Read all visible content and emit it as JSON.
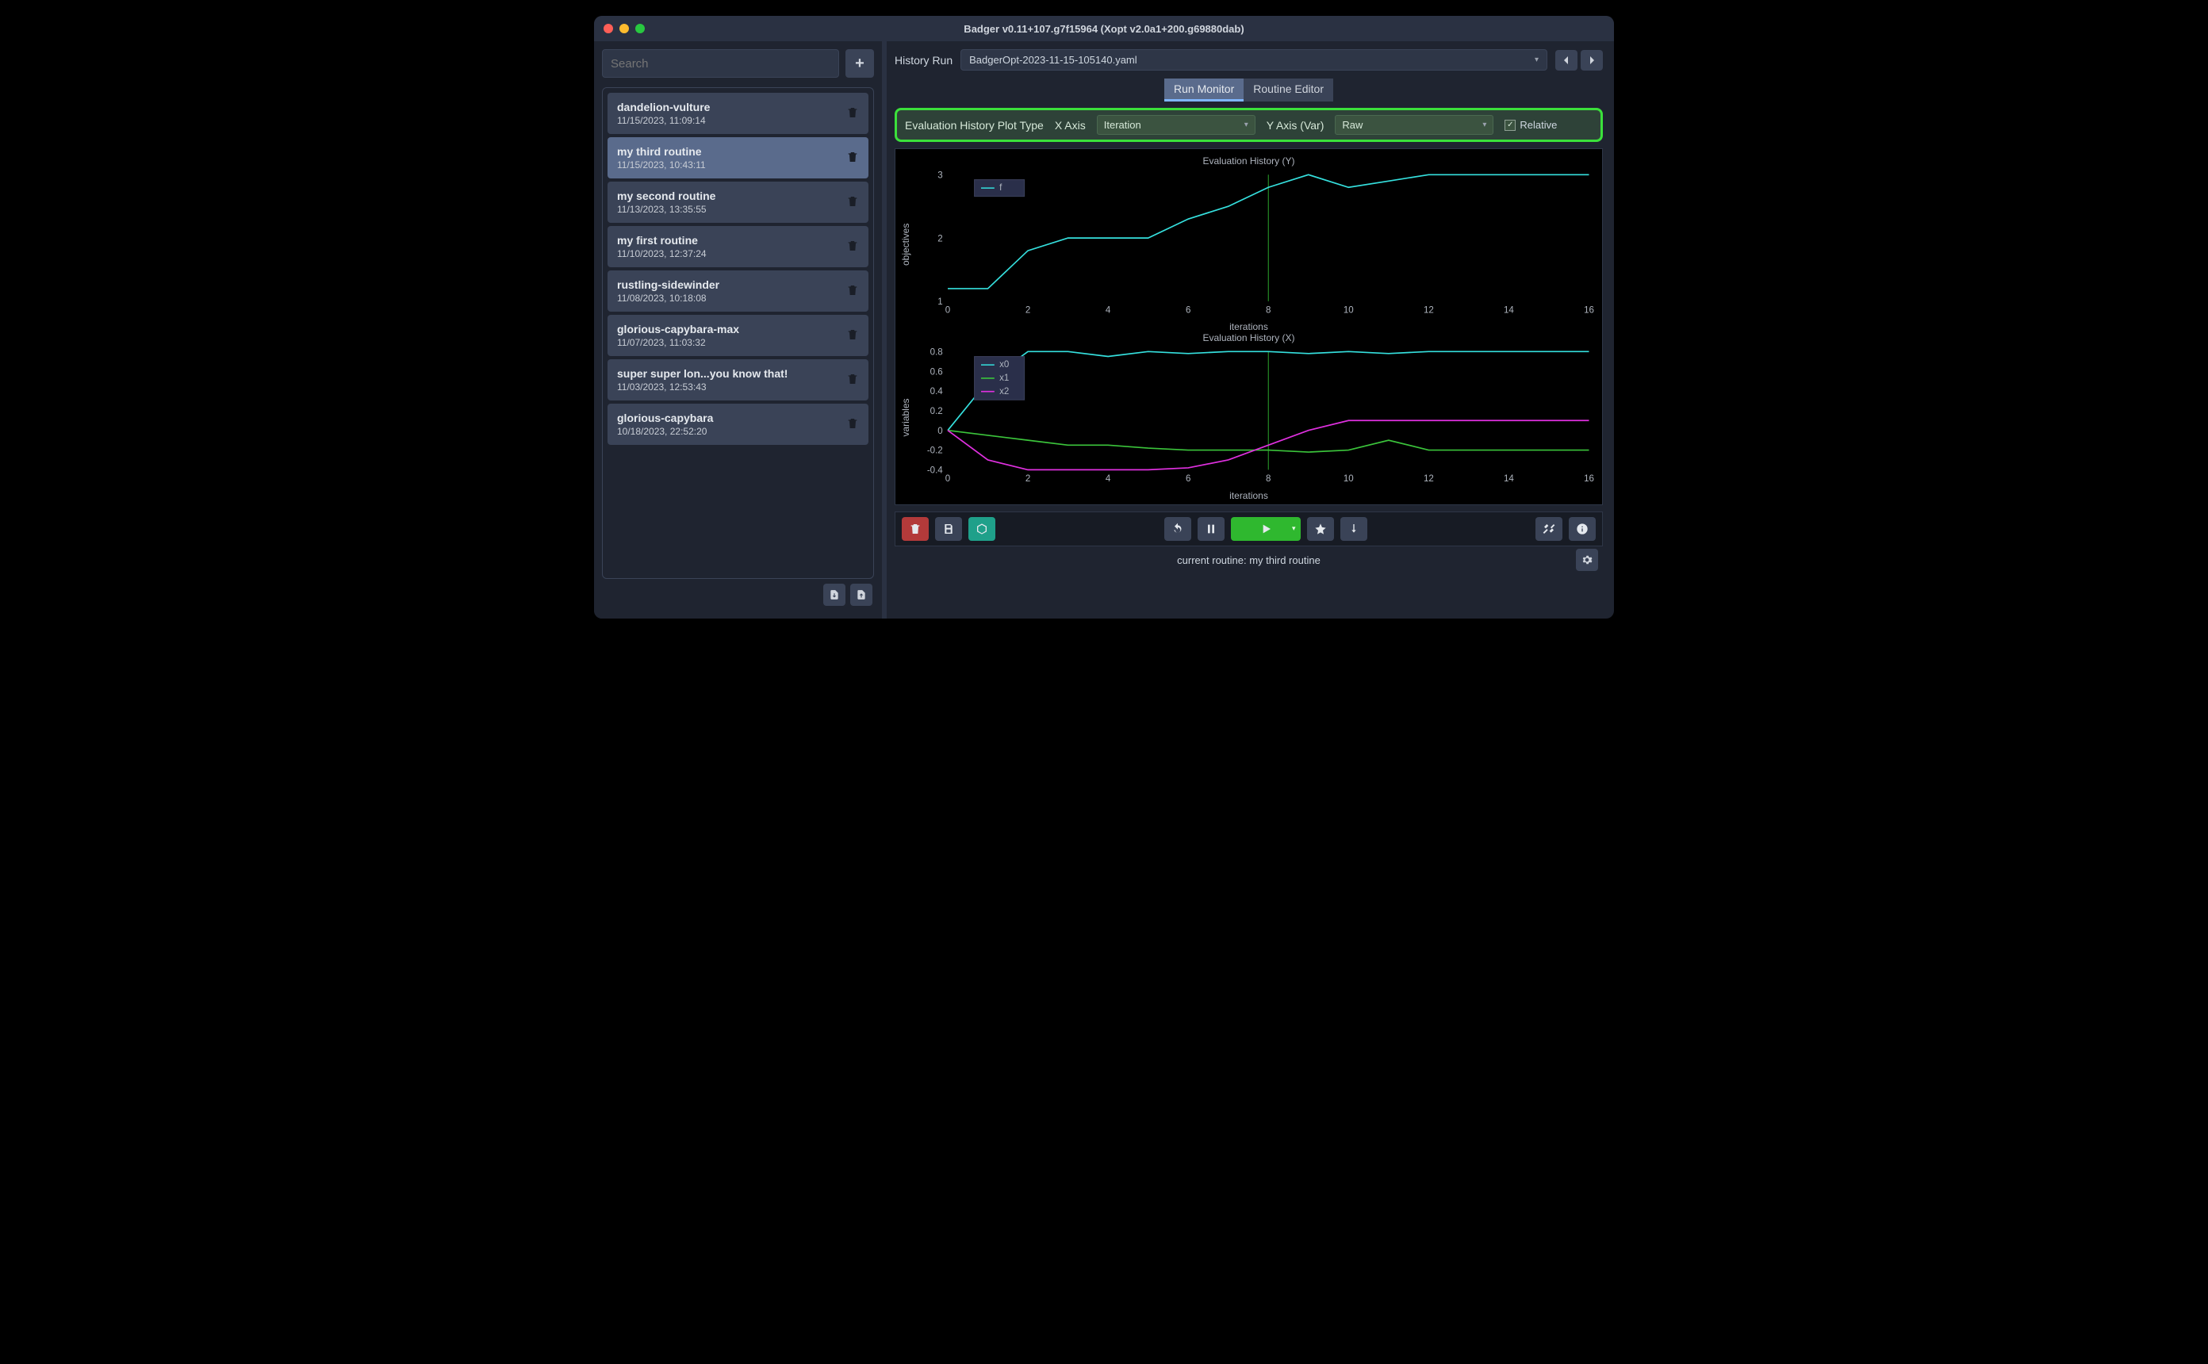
{
  "window": {
    "title": "Badger v0.11+107.g7f15964 (Xopt v2.0a1+200.g69880dab)"
  },
  "sidebar": {
    "search_placeholder": "Search",
    "routines": [
      {
        "name": "dandelion-vulture",
        "date": "11/15/2023, 11:09:14",
        "selected": false
      },
      {
        "name": "my third routine",
        "date": "11/15/2023, 10:43:11",
        "selected": true
      },
      {
        "name": "my second routine",
        "date": "11/13/2023, 13:35:55",
        "selected": false
      },
      {
        "name": "my first routine",
        "date": "11/10/2023, 12:37:24",
        "selected": false
      },
      {
        "name": "rustling-sidewinder",
        "date": "11/08/2023, 10:18:08",
        "selected": false
      },
      {
        "name": "glorious-capybara-max",
        "date": "11/07/2023, 11:03:32",
        "selected": false
      },
      {
        "name": "super super lon...you know that!",
        "date": "11/03/2023, 12:53:43",
        "selected": false
      },
      {
        "name": "glorious-capybara",
        "date": "10/18/2023, 22:52:20",
        "selected": false
      }
    ]
  },
  "history": {
    "label": "History Run",
    "value": "BadgerOpt-2023-11-15-105140.yaml"
  },
  "tabs": {
    "items": [
      "Run Monitor",
      "Routine Editor"
    ],
    "active": 0
  },
  "plotctrl": {
    "label": "Evaluation History Plot Type",
    "xaxis_label": "X Axis",
    "xaxis_value": "Iteration",
    "yaxis_label": "Y Axis (Var)",
    "yaxis_value": "Raw",
    "relative_label": "Relative",
    "relative_checked": true
  },
  "footer": {
    "text": "current routine: my third routine"
  },
  "chart_data": [
    {
      "type": "line",
      "title": "Evaluation History (Y)",
      "xlabel": "iterations",
      "ylabel": "objectives",
      "xlim": [
        0,
        16
      ],
      "ylim": [
        1,
        3
      ],
      "x": [
        0,
        1,
        2,
        3,
        4,
        5,
        6,
        7,
        8,
        9,
        10,
        11,
        12,
        13,
        14,
        15,
        16
      ],
      "series": [
        {
          "name": "f",
          "color": "#35e0de",
          "values": [
            1.2,
            1.2,
            1.8,
            2.0,
            2.0,
            2.0,
            2.3,
            2.5,
            2.8,
            3.0,
            2.8,
            2.9,
            3.0,
            3.0,
            3.0,
            3.0,
            3.0
          ]
        }
      ],
      "highlight_x": 8
    },
    {
      "type": "line",
      "title": "Evaluation History (X)",
      "xlabel": "iterations",
      "ylabel": "variables",
      "xlim": [
        0,
        16
      ],
      "ylim": [
        -0.4,
        0.8
      ],
      "x": [
        0,
        1,
        2,
        3,
        4,
        5,
        6,
        7,
        8,
        9,
        10,
        11,
        12,
        13,
        14,
        15,
        16
      ],
      "series": [
        {
          "name": "x0",
          "color": "#35e0de",
          "values": [
            0.0,
            0.5,
            0.8,
            0.8,
            0.75,
            0.8,
            0.78,
            0.8,
            0.8,
            0.78,
            0.8,
            0.78,
            0.8,
            0.8,
            0.8,
            0.8,
            0.8
          ]
        },
        {
          "name": "x1",
          "color": "#3bc43b",
          "values": [
            0.0,
            -0.05,
            -0.1,
            -0.15,
            -0.15,
            -0.18,
            -0.2,
            -0.2,
            -0.2,
            -0.22,
            -0.2,
            -0.1,
            -0.2,
            -0.2,
            -0.2,
            -0.2,
            -0.2
          ]
        },
        {
          "name": "x2",
          "color": "#e030e0",
          "values": [
            0.0,
            -0.3,
            -0.4,
            -0.4,
            -0.4,
            -0.4,
            -0.38,
            -0.3,
            -0.15,
            0.0,
            0.1,
            0.1,
            0.1,
            0.1,
            0.1,
            0.1,
            0.1
          ]
        }
      ],
      "highlight_x": 8
    }
  ]
}
